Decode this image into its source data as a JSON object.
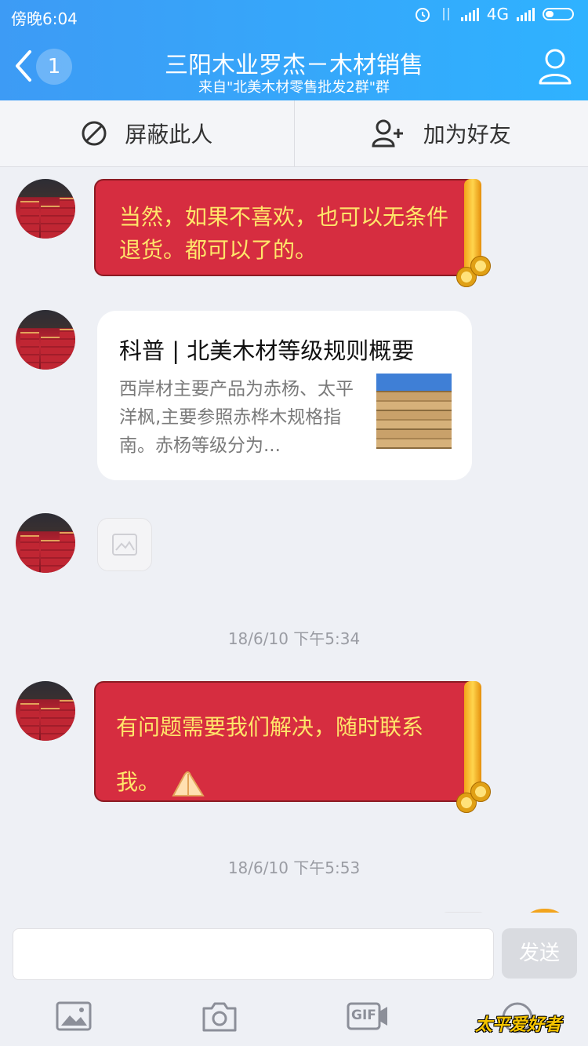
{
  "status_bar": {
    "time": "傍晚6:04",
    "network": "4G"
  },
  "header": {
    "back_count": "1",
    "title": "三阳木业罗杰－木材销售",
    "subtitle": "来自\"北美木材零售批发2群\"群"
  },
  "actions": {
    "block_label": "屏蔽此人",
    "add_friend_label": "加为好友"
  },
  "messages": [
    {
      "type": "text",
      "text": "当然，如果不喜欢，也可以无条件退货。都可以了的。"
    },
    {
      "type": "card",
      "title": "科普 | 北美木材等级规则概要",
      "description": "西岸材主要产品为赤杨、太平洋枫,主要参照赤桦木规格指南。赤杨等级分为..."
    },
    {
      "type": "emoji-placeholder"
    },
    {
      "type": "timestamp",
      "text": "18/6/10 下午5:34"
    },
    {
      "type": "text",
      "text": "有问题需要我们解决，随时联系我。"
    },
    {
      "type": "timestamp",
      "text": "18/6/10 下午5:53"
    }
  ],
  "input": {
    "value": "",
    "send_label": "发送"
  },
  "toolbar": {
    "gif_label": "GIF"
  },
  "watermark": "太平爱好者",
  "colors": {
    "header": "#3d9bf5",
    "bubble_red": "#d62d40",
    "bubble_text": "#ffe56a",
    "background": "#eef0f5"
  }
}
